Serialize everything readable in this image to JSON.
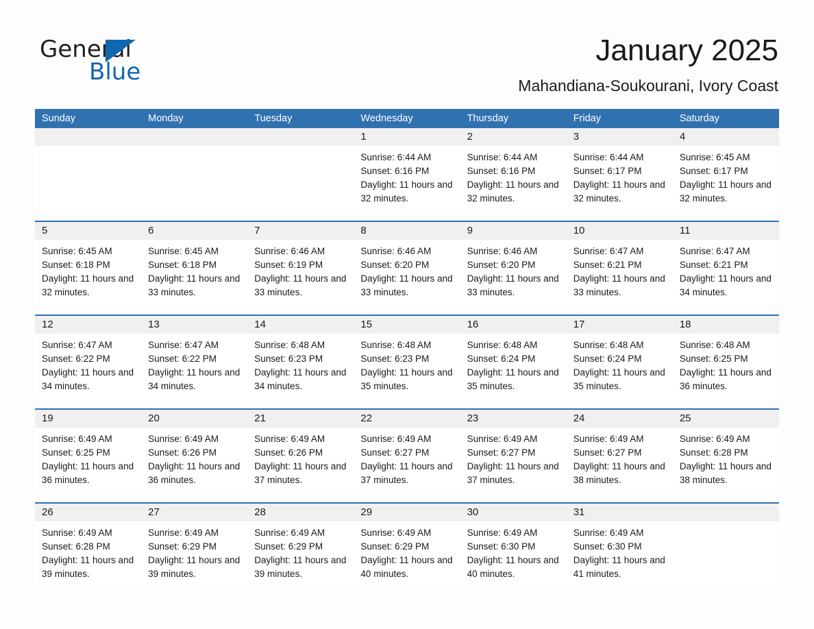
{
  "brand": {
    "word_general": "General",
    "word_blue": "Blue",
    "triangle_color": "#1166b0"
  },
  "header": {
    "month_title": "January 2025",
    "location": "Mahandiana-Soukourani, Ivory Coast",
    "accent_color": "#3071b0",
    "date_band_color": "#f0f0f0"
  },
  "calendar": {
    "weekdays": [
      "Sunday",
      "Monday",
      "Tuesday",
      "Wednesday",
      "Thursday",
      "Friday",
      "Saturday"
    ],
    "weeks": [
      [
        {
          "date": "",
          "sunrise": "",
          "sunset": "",
          "daylight": ""
        },
        {
          "date": "",
          "sunrise": "",
          "sunset": "",
          "daylight": ""
        },
        {
          "date": "",
          "sunrise": "",
          "sunset": "",
          "daylight": ""
        },
        {
          "date": "1",
          "sunrise": "Sunrise: 6:44 AM",
          "sunset": "Sunset: 6:16 PM",
          "daylight": "Daylight: 11 hours and 32 minutes."
        },
        {
          "date": "2",
          "sunrise": "Sunrise: 6:44 AM",
          "sunset": "Sunset: 6:16 PM",
          "daylight": "Daylight: 11 hours and 32 minutes."
        },
        {
          "date": "3",
          "sunrise": "Sunrise: 6:44 AM",
          "sunset": "Sunset: 6:17 PM",
          "daylight": "Daylight: 11 hours and 32 minutes."
        },
        {
          "date": "4",
          "sunrise": "Sunrise: 6:45 AM",
          "sunset": "Sunset: 6:17 PM",
          "daylight": "Daylight: 11 hours and 32 minutes."
        }
      ],
      [
        {
          "date": "5",
          "sunrise": "Sunrise: 6:45 AM",
          "sunset": "Sunset: 6:18 PM",
          "daylight": "Daylight: 11 hours and 32 minutes."
        },
        {
          "date": "6",
          "sunrise": "Sunrise: 6:45 AM",
          "sunset": "Sunset: 6:18 PM",
          "daylight": "Daylight: 11 hours and 33 minutes."
        },
        {
          "date": "7",
          "sunrise": "Sunrise: 6:46 AM",
          "sunset": "Sunset: 6:19 PM",
          "daylight": "Daylight: 11 hours and 33 minutes."
        },
        {
          "date": "8",
          "sunrise": "Sunrise: 6:46 AM",
          "sunset": "Sunset: 6:20 PM",
          "daylight": "Daylight: 11 hours and 33 minutes."
        },
        {
          "date": "9",
          "sunrise": "Sunrise: 6:46 AM",
          "sunset": "Sunset: 6:20 PM",
          "daylight": "Daylight: 11 hours and 33 minutes."
        },
        {
          "date": "10",
          "sunrise": "Sunrise: 6:47 AM",
          "sunset": "Sunset: 6:21 PM",
          "daylight": "Daylight: 11 hours and 33 minutes."
        },
        {
          "date": "11",
          "sunrise": "Sunrise: 6:47 AM",
          "sunset": "Sunset: 6:21 PM",
          "daylight": "Daylight: 11 hours and 34 minutes."
        }
      ],
      [
        {
          "date": "12",
          "sunrise": "Sunrise: 6:47 AM",
          "sunset": "Sunset: 6:22 PM",
          "daylight": "Daylight: 11 hours and 34 minutes."
        },
        {
          "date": "13",
          "sunrise": "Sunrise: 6:47 AM",
          "sunset": "Sunset: 6:22 PM",
          "daylight": "Daylight: 11 hours and 34 minutes."
        },
        {
          "date": "14",
          "sunrise": "Sunrise: 6:48 AM",
          "sunset": "Sunset: 6:23 PM",
          "daylight": "Daylight: 11 hours and 34 minutes."
        },
        {
          "date": "15",
          "sunrise": "Sunrise: 6:48 AM",
          "sunset": "Sunset: 6:23 PM",
          "daylight": "Daylight: 11 hours and 35 minutes."
        },
        {
          "date": "16",
          "sunrise": "Sunrise: 6:48 AM",
          "sunset": "Sunset: 6:24 PM",
          "daylight": "Daylight: 11 hours and 35 minutes."
        },
        {
          "date": "17",
          "sunrise": "Sunrise: 6:48 AM",
          "sunset": "Sunset: 6:24 PM",
          "daylight": "Daylight: 11 hours and 35 minutes."
        },
        {
          "date": "18",
          "sunrise": "Sunrise: 6:48 AM",
          "sunset": "Sunset: 6:25 PM",
          "daylight": "Daylight: 11 hours and 36 minutes."
        }
      ],
      [
        {
          "date": "19",
          "sunrise": "Sunrise: 6:49 AM",
          "sunset": "Sunset: 6:25 PM",
          "daylight": "Daylight: 11 hours and 36 minutes."
        },
        {
          "date": "20",
          "sunrise": "Sunrise: 6:49 AM",
          "sunset": "Sunset: 6:26 PM",
          "daylight": "Daylight: 11 hours and 36 minutes."
        },
        {
          "date": "21",
          "sunrise": "Sunrise: 6:49 AM",
          "sunset": "Sunset: 6:26 PM",
          "daylight": "Daylight: 11 hours and 37 minutes."
        },
        {
          "date": "22",
          "sunrise": "Sunrise: 6:49 AM",
          "sunset": "Sunset: 6:27 PM",
          "daylight": "Daylight: 11 hours and 37 minutes."
        },
        {
          "date": "23",
          "sunrise": "Sunrise: 6:49 AM",
          "sunset": "Sunset: 6:27 PM",
          "daylight": "Daylight: 11 hours and 37 minutes."
        },
        {
          "date": "24",
          "sunrise": "Sunrise: 6:49 AM",
          "sunset": "Sunset: 6:27 PM",
          "daylight": "Daylight: 11 hours and 38 minutes."
        },
        {
          "date": "25",
          "sunrise": "Sunrise: 6:49 AM",
          "sunset": "Sunset: 6:28 PM",
          "daylight": "Daylight: 11 hours and 38 minutes."
        }
      ],
      [
        {
          "date": "26",
          "sunrise": "Sunrise: 6:49 AM",
          "sunset": "Sunset: 6:28 PM",
          "daylight": "Daylight: 11 hours and 39 minutes."
        },
        {
          "date": "27",
          "sunrise": "Sunrise: 6:49 AM",
          "sunset": "Sunset: 6:29 PM",
          "daylight": "Daylight: 11 hours and 39 minutes."
        },
        {
          "date": "28",
          "sunrise": "Sunrise: 6:49 AM",
          "sunset": "Sunset: 6:29 PM",
          "daylight": "Daylight: 11 hours and 39 minutes."
        },
        {
          "date": "29",
          "sunrise": "Sunrise: 6:49 AM",
          "sunset": "Sunset: 6:29 PM",
          "daylight": "Daylight: 11 hours and 40 minutes."
        },
        {
          "date": "30",
          "sunrise": "Sunrise: 6:49 AM",
          "sunset": "Sunset: 6:30 PM",
          "daylight": "Daylight: 11 hours and 40 minutes."
        },
        {
          "date": "31",
          "sunrise": "Sunrise: 6:49 AM",
          "sunset": "Sunset: 6:30 PM",
          "daylight": "Daylight: 11 hours and 41 minutes."
        },
        {
          "date": "",
          "sunrise": "",
          "sunset": "",
          "daylight": ""
        }
      ]
    ]
  }
}
